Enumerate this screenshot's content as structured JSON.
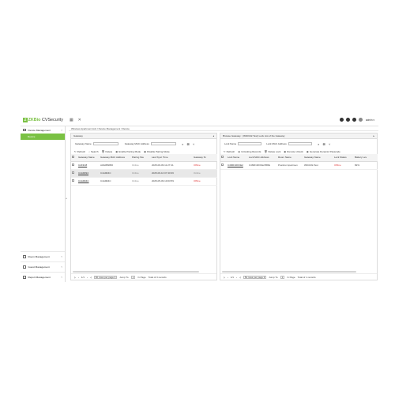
{
  "app": {
    "logo_mark": "Z",
    "logo_zk": "ZKBio",
    "logo_rest": " CVSecurity",
    "icons": [
      "grid-icon",
      "close-icon"
    ],
    "user": "admin ▾"
  },
  "sidebar": {
    "section_label": "Device Management",
    "active_item": "Device",
    "bottom_items": [
      {
        "label": "Room Management"
      },
      {
        "label": "Guest Management"
      },
      {
        "label": "Report Management"
      }
    ]
  },
  "breadcrumb": "Wireless Apartment lock / Device Management / Device",
  "gateway_panel": {
    "title": "Gateway",
    "search": {
      "gateway_name_label": "Gateway Name",
      "gateway_mac_label": "Gateway MAC Address"
    },
    "toolbar": [
      {
        "icon": "↻",
        "label": "Refresh"
      },
      {
        "icon": "⌕",
        "label": "Search"
      },
      {
        "icon": "🗑",
        "label": "Delete"
      },
      {
        "icon": "▣",
        "label": "Enable Pairing Mode"
      },
      {
        "icon": "▣",
        "label": "Disable Pairing Mode"
      }
    ],
    "columns": [
      "",
      "Gateway Name",
      "Gateway MAC Address",
      "Pairing Sta",
      "Last Sync Time",
      "Gateway St"
    ],
    "rows": [
      {
        "name": "C2F3C8",
        "mac": "A0A0B9950",
        "pairing": "Online",
        "sync": "2025-06-09 11:27:41",
        "status": "Offline",
        "status_class": "status-offline",
        "selected": false
      },
      {
        "name": "C4A9D94",
        "mac": "C4A9D4C",
        "pairing": "Online",
        "sync": "2025-06-10 07:40:36",
        "status": "Online",
        "status_class": "status-online",
        "selected": true
      },
      {
        "name": "C4A9D4C",
        "mac": "C4A9D4C",
        "pairing": "Online",
        "sync": "2025-05-09 10:03:59",
        "status": "Offline",
        "status_class": "status-offline",
        "selected": false
      }
    ],
    "pager": {
      "first": "|‹",
      "prev": "‹",
      "page": "1/1",
      "next": "›",
      "last": "›|",
      "per_page": "50 rows per page ▾",
      "jump": "Jump To",
      "jump_value": "1",
      "page_suffix": "/1 Page",
      "total": "Total of 3 records"
    }
  },
  "lock_panel": {
    "title": "Browse Gateway : (WiFiGW-Test) Lock List of the Gateway",
    "search": {
      "lock_name_label": "Lock Name",
      "lock_mac_label": "Lock MAC Address"
    },
    "toolbar": [
      {
        "icon": "↻",
        "label": "Refresh"
      },
      {
        "icon": "▤",
        "label": "Unlocking Records"
      },
      {
        "icon": "🗑",
        "label": "Delete Lock"
      },
      {
        "icon": "▣",
        "label": "Remote Unlock"
      },
      {
        "icon": "▣",
        "label": "Generate Dynamic Passcode"
      }
    ],
    "columns": [
      "",
      "Lock Name",
      "Lock MAC Address",
      "Room Name",
      "Gateway Name",
      "Lock Status",
      "Battery Lev"
    ],
    "rows": [
      {
        "name": "C466F4FFFE2",
        "mac": "C466F4FFFE2358E",
        "room": "Positron Apartmen",
        "gateway": "WiFiGW-Test",
        "status": "Offline",
        "battery": "82%"
      }
    ],
    "pager": {
      "first": "|‹",
      "prev": "‹",
      "page": "1/1",
      "next": "›",
      "last": "›|",
      "per_page": "50 rows per page ▾",
      "jump": "Jump To",
      "jump_value": "1",
      "page_suffix": "/1 Page",
      "total": "Total of 1 records"
    }
  }
}
